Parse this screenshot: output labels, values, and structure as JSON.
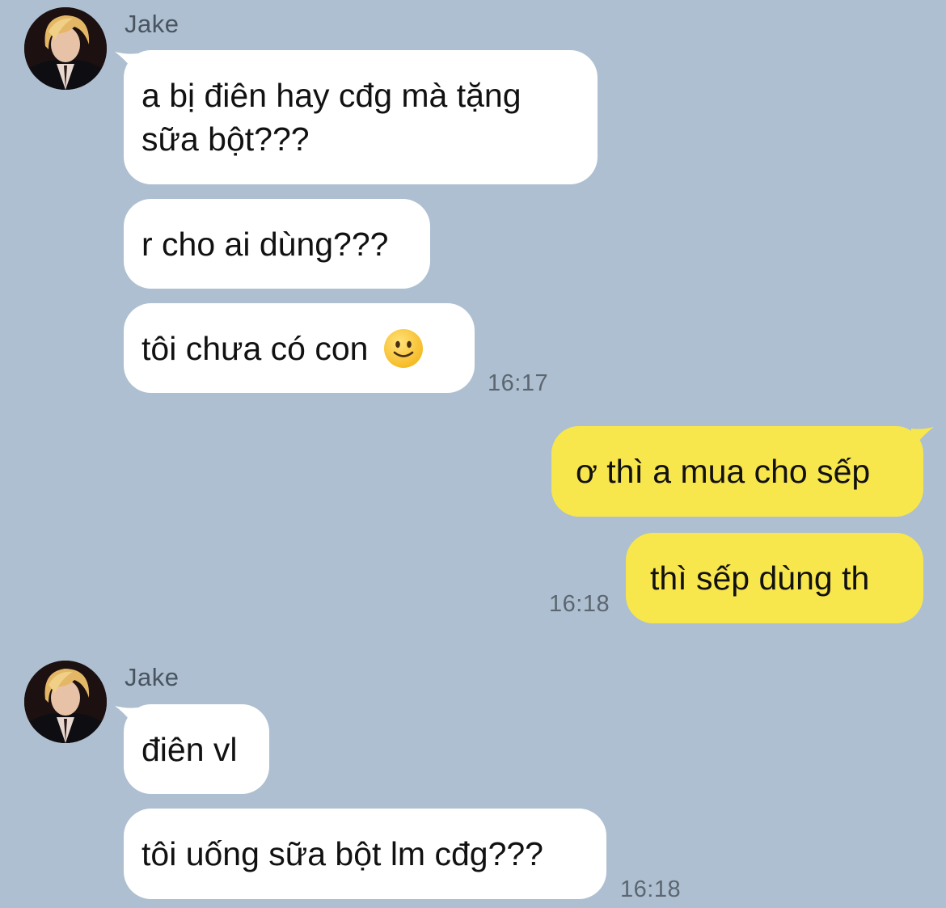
{
  "conversation": {
    "group1": {
      "sender": "Jake",
      "messages": [
        "a bị điên hay cđg mà tặng sữa bột???",
        "r cho ai dùng???",
        "tôi chưa có con"
      ],
      "emoji": "slightly-smiling-face-emoji",
      "time": "16:17"
    },
    "outgoing": {
      "messages": [
        "ơ thì a mua cho sếp",
        "thì sếp dùng th"
      ],
      "time": "16:18"
    },
    "group2": {
      "sender": "Jake",
      "messages": [
        "điên vl",
        "tôi uống sữa bột lm cđg???"
      ],
      "time": "16:18"
    }
  },
  "colors": {
    "background": "#adbfd0",
    "incoming_bubble": "#ffffff",
    "outgoing_bubble": "#f8e64d"
  }
}
